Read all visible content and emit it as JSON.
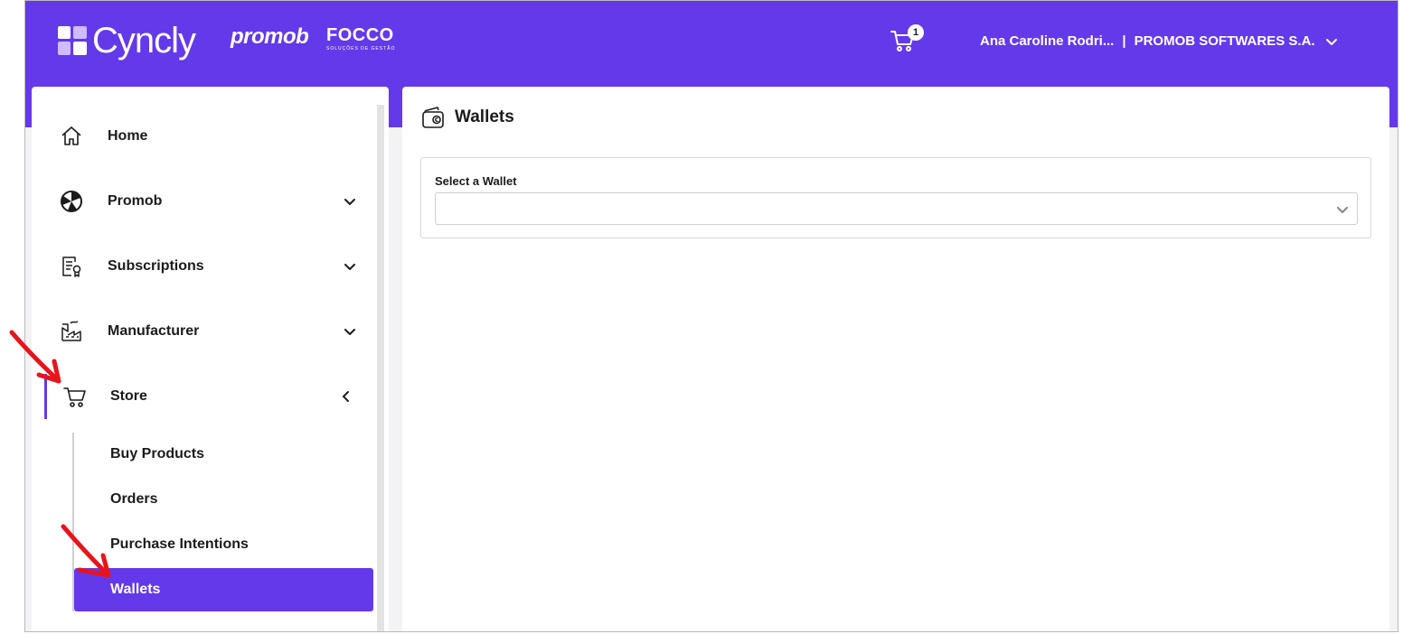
{
  "header": {
    "brand": "Cyncly",
    "brand_secondary": "promob",
    "brand_tertiary": "FOCCO",
    "brand_tertiary_sub": "SOLUÇÕES DE GESTÃO",
    "cart_count": "1",
    "user_name": "Ana Caroline Rodri...",
    "separator": "|",
    "company": "PROMOB SOFTWARES S.A.",
    "bg_color": "#6439ea"
  },
  "sidebar": {
    "items": [
      {
        "label": "Home",
        "icon": "home-icon",
        "expandable": false
      },
      {
        "label": "Promob",
        "icon": "promob-icon",
        "expandable": true
      },
      {
        "label": "Subscriptions",
        "icon": "subscriptions-icon",
        "expandable": true
      },
      {
        "label": "Manufacturer",
        "icon": "factory-icon",
        "expandable": true
      },
      {
        "label": "Store",
        "icon": "cart-icon",
        "expandable": true,
        "expanded": true
      }
    ],
    "store_subitems": [
      {
        "label": "Buy Products"
      },
      {
        "label": "Orders"
      },
      {
        "label": "Purchase Intentions"
      },
      {
        "label": "Wallets",
        "selected": true
      }
    ],
    "accent_color": "#6439ea"
  },
  "main": {
    "title": "Wallets",
    "title_icon": "wallet-icon",
    "select_label": "Select a Wallet",
    "select_value": ""
  },
  "annotations": {
    "arrow_color": "#e8141c",
    "arrows": [
      "red-arrow-to-store",
      "red-arrow-to-wallets"
    ]
  }
}
